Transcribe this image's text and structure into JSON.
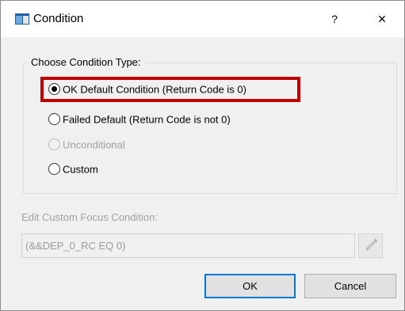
{
  "window": {
    "title": "Condition",
    "help_label": "?",
    "close_label": "×"
  },
  "condition_type": {
    "group_label": "Choose Condition Type:",
    "options": [
      {
        "label": "OK Default Condition (Return Code is 0)",
        "selected": true,
        "enabled": true,
        "highlighted": true
      },
      {
        "label": "Failed Default (Return Code is not 0)",
        "selected": false,
        "enabled": true
      },
      {
        "label": "Unconditional",
        "selected": false,
        "enabled": false
      },
      {
        "label": "Custom",
        "selected": false,
        "enabled": true
      }
    ]
  },
  "custom_condition": {
    "label": "Edit Custom Focus Condition:",
    "value": "(&&DEP_0_RC EQ 0)",
    "enabled": false,
    "edit_icon": "pencil-icon"
  },
  "buttons": {
    "ok_label": "OK",
    "cancel_label": "Cancel"
  },
  "colors": {
    "highlight_border": "#c00000",
    "default_button_border": "#0078d7",
    "disabled_text": "#a0a0a0"
  }
}
